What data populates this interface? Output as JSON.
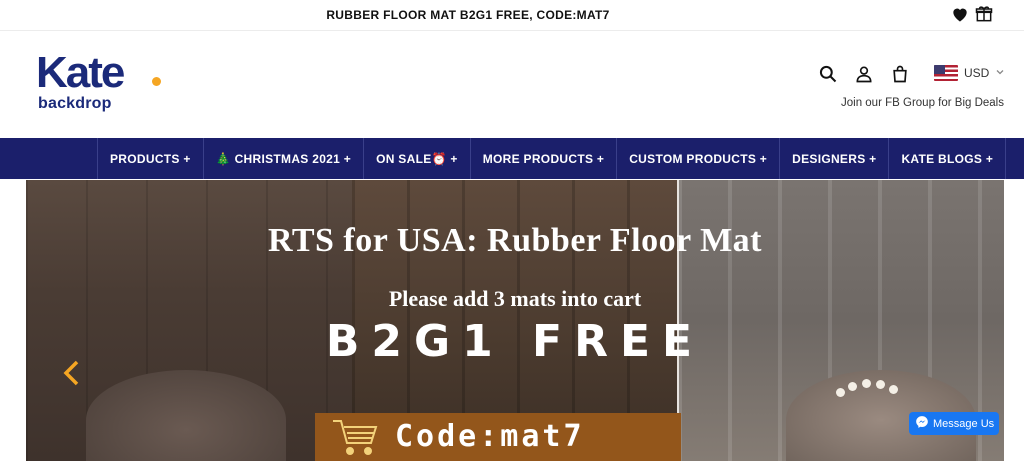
{
  "announcement": {
    "text": "RUBBER FLOOR MAT B2G1 FREE, CODE:MAT7"
  },
  "announcement_icons": [
    "heart-icon",
    "gift-icon"
  ],
  "logo": {
    "main": "Kate",
    "sub": "backdrop"
  },
  "header_icons": [
    "search-icon",
    "account-icon",
    "cart-icon"
  ],
  "currency": {
    "selected": "USD"
  },
  "fb_group": {
    "text": "Join our FB Group for Big Deals"
  },
  "nav": {
    "items": [
      {
        "label": "PRODUCTS +"
      },
      {
        "label": "🎄 CHRISTMAS 2021 +"
      },
      {
        "label": "ON SALE⏰ +"
      },
      {
        "label": "MORE PRODUCTS +"
      },
      {
        "label": "CUSTOM PRODUCTS +"
      },
      {
        "label": "DESIGNERS +"
      },
      {
        "label": "KATE BLOGS +"
      }
    ]
  },
  "banner": {
    "title": "RTS for USA: Rubber Floor Mat",
    "subtitle": "Please add 3 mats into cart",
    "offer": "B2G1 FREE",
    "code": "Code:mat7"
  },
  "messenger": {
    "label": "Message Us"
  },
  "colors": {
    "nav_bg": "#1b1f6b",
    "brand": "#1b2a7a",
    "accent": "#f5a623",
    "code_bg": "#93561b",
    "messenger": "#1877f2"
  }
}
